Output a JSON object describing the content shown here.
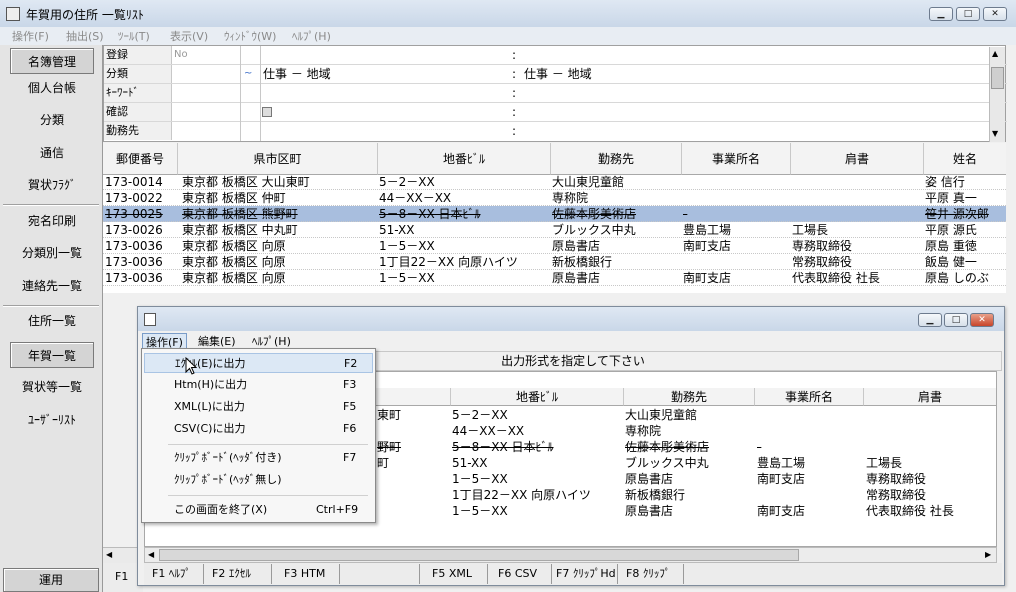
{
  "window": {
    "title": "年賀用の住所 一覧ﾘｽﾄ"
  },
  "menubar": [
    "操作(F)",
    "抽出(S)",
    "ﾂｰﾙ(T)",
    "表示(V)",
    "ｳｨﾝﾄﾞｳ(W)",
    "ﾍﾙﾌﾟ(H)"
  ],
  "sidebar": {
    "items": [
      "名簿管理",
      "個人台帳",
      "分類",
      "通信",
      "賀状ﾌﾗｸﾞ",
      "宛名印刷",
      "分類別一覧",
      "連絡先一覧",
      "住所一覧",
      "年賀一覧",
      "賀状等一覧",
      "ﾕｰｻﾞｰﾘｽﾄ"
    ],
    "bottom_button": "運用"
  },
  "criteria": {
    "rows": [
      {
        "label": "登録",
        "mark": "No",
        "value": "",
        "value2": ""
      },
      {
        "label": "分類",
        "mark": "~",
        "value": "仕事 － 地域",
        "value2": "仕事 － 地域"
      },
      {
        "label": "ｷｰﾜｰﾄﾞ",
        "mark": "",
        "value": "",
        "value2": ""
      },
      {
        "label": "確認",
        "mark": "",
        "value": "",
        "value2": ""
      },
      {
        "label": "勤務先",
        "mark": "",
        "value": "",
        "value2": ""
      }
    ],
    "separator": ":"
  },
  "table": {
    "headers": [
      "郵便番号",
      "県市区町",
      "地番ﾋﾞﾙ",
      "勤務先",
      "事業所名",
      "肩書",
      "姓名"
    ],
    "rows": [
      [
        "173-0014",
        "東京都 板橋区 大山東町",
        "5－2－XX",
        "大山東児童館",
        "",
        "",
        "姿 信行"
      ],
      [
        "173-0022",
        "東京都 板橋区 仲町",
        "44－XX－XX",
        "専称院",
        "",
        "",
        "平原 真一"
      ],
      [
        "173-0025",
        "東京都 板橋区 熊野町",
        "5－8－XX 日本ﾋﾞﾙ",
        "佐藤本彫美術店",
        "-",
        "",
        "笹井 源次郎"
      ],
      [
        "173-0026",
        "東京都 板橋区 中丸町",
        "51-XX",
        "ブルックス中丸",
        "豊島工場",
        "工場長",
        "平原 源氏"
      ],
      [
        "173-0036",
        "東京都 板橋区 向原",
        "1－5－XX",
        "原島書店",
        "南町支店",
        "専務取締役",
        "原島 重徳"
      ],
      [
        "173-0036",
        "東京都 板橋区 向原",
        "1丁目22－XX 向原ハイツ",
        "新板橋銀行",
        "",
        "常務取締役",
        "飯島 健一"
      ],
      [
        "173-0036",
        "東京都 板橋区 向原",
        "1－5－XX",
        "原島書店",
        "南町支店",
        "代表取締役 社長",
        "原島 しのぶ"
      ]
    ],
    "selected_row": 2
  },
  "main_fkey": "F1",
  "subwindow": {
    "menu": [
      "操作(F)",
      "編集(E)",
      "ﾍﾙﾌﾟ(H)"
    ],
    "message": "出力形式を指定して下さい",
    "headers": [
      "地番ﾋﾞﾙ",
      "勤務先",
      "事業所名",
      "肩書"
    ],
    "rows": [
      [
        "東町",
        "5－2－XX",
        "大山東児童館",
        "",
        ""
      ],
      [
        "",
        "44－XX－XX",
        "専称院",
        "",
        ""
      ],
      [
        "野町",
        "5－8－XX 日本ﾋﾞﾙ",
        "佐藤本彫美術店",
        "-",
        ""
      ],
      [
        "町",
        "51-XX",
        "ブルックス中丸",
        "豊島工場",
        "工場長"
      ],
      [
        "",
        "1－5－XX",
        "原島書店",
        "南町支店",
        "専務取締役"
      ],
      [
        "",
        "1丁目22－XX 向原ハイツ",
        "新板橋銀行",
        "",
        "常務取締役"
      ],
      [
        "",
        "1－5－XX",
        "原島書店",
        "南町支店",
        "代表取締役 社長"
      ]
    ],
    "fkeys": [
      "F1 ﾍﾙﾌﾟ",
      "F2 ｴｸｾﾙ",
      "F3 HTM",
      "",
      "F5 XML",
      "F6 CSV",
      "F7 ｸﾘｯﾌﾟHd",
      "F8 ｸﾘｯﾌﾟ"
    ]
  },
  "dropdown": {
    "items": [
      {
        "label": "ｴｸｾﾙ(E)に出力",
        "shortcut": "F2"
      },
      {
        "label": "Htm(H)に出力",
        "shortcut": "F3"
      },
      {
        "label": "XML(L)に出力",
        "shortcut": "F5"
      },
      {
        "label": "CSV(C)に出力",
        "shortcut": "F6"
      },
      {
        "label": "ｸﾘｯﾌﾟﾎﾞｰﾄﾞ(ﾍｯﾀﾞ付き)",
        "shortcut": "F7"
      },
      {
        "label": "ｸﾘｯﾌﾟﾎﾞｰﾄﾞ(ﾍｯﾀﾞ無し)",
        "shortcut": ""
      },
      {
        "label": "この画面を終了(X)",
        "shortcut": "Ctrl+F9"
      }
    ]
  }
}
